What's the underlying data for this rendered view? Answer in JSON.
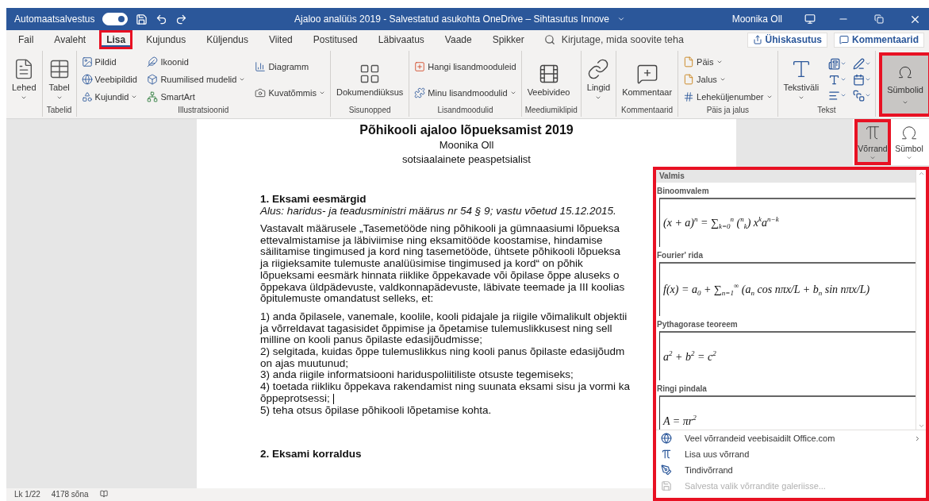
{
  "title_bar": {
    "autosave_label": "Automaatsalvestus",
    "autosave_on": true,
    "title": "Ajaloo analüüs 2019  -  Salvestatud asukohta OneDrive – Sihtasutus Innove",
    "user": "Moonika Oll"
  },
  "tabs": [
    {
      "label": "Fail",
      "selected": false,
      "highlighted": false
    },
    {
      "label": "Avaleht",
      "selected": false,
      "highlighted": false
    },
    {
      "label": "Lisa",
      "selected": true,
      "highlighted": true
    },
    {
      "label": "Kujundus",
      "selected": false,
      "highlighted": false
    },
    {
      "label": "Küljendus",
      "selected": false,
      "highlighted": false
    },
    {
      "label": "Viited",
      "selected": false,
      "highlighted": false
    },
    {
      "label": "Postitused",
      "selected": false,
      "highlighted": false
    },
    {
      "label": "Läbivaatus",
      "selected": false,
      "highlighted": false
    },
    {
      "label": "Vaade",
      "selected": false,
      "highlighted": false
    },
    {
      "label": "Spikker",
      "selected": false,
      "highlighted": false
    }
  ],
  "search": {
    "placeholder": "Kirjutage, mida soovite teha"
  },
  "share_button": "Ühiskasutus",
  "comments_button": "Kommentaarid",
  "ribbon": {
    "groups": [
      {
        "columns": [
          [
            {
              "label": "Lehed",
              "kind": "large",
              "dropdown": true
            }
          ]
        ]
      },
      {
        "label": "Tabelid",
        "columns": [
          [
            {
              "label": "Tabel",
              "kind": "large",
              "dropdown": true
            }
          ]
        ]
      },
      {
        "label": "Illustratsioonid",
        "columns": [
          [
            {
              "label": "Pildid",
              "kind": "small",
              "dropdown": false
            },
            {
              "label": "Veebipildid",
              "kind": "small",
              "dropdown": false
            },
            {
              "label": "Kujundid",
              "kind": "small",
              "dropdown": true
            }
          ],
          [
            {
              "label": "Ikoonid",
              "kind": "small",
              "dropdown": false
            },
            {
              "label": "Ruumilised mudelid",
              "kind": "small",
              "dropdown": true
            },
            {
              "label": "SmartArt",
              "kind": "small",
              "dropdown": false
            }
          ],
          [
            {
              "label": "Diagramm",
              "kind": "small",
              "dropdown": false
            },
            {
              "label": "Kuvatõmmis",
              "kind": "small",
              "dropdown": true
            }
          ]
        ]
      },
      {
        "label": "Sisunopped",
        "columns": [
          [
            {
              "label": "Dokumendiüksus",
              "kind": "large",
              "dropdown": false
            }
          ]
        ]
      },
      {
        "label": "Lisandmoodulid",
        "columns": [
          [
            {
              "label": "Hangi lisandmooduleid",
              "kind": "small",
              "dropdown": false
            },
            {
              "label": "Minu lisandmoodulid",
              "kind": "small",
              "dropdown": true
            }
          ]
        ]
      },
      {
        "label": "Meediumiklipid",
        "columns": [
          [
            {
              "label": "Veebivideo",
              "kind": "large",
              "dropdown": false
            }
          ]
        ]
      },
      {
        "columns": [
          [
            {
              "label": "Lingid",
              "kind": "large",
              "dropdown": true
            }
          ]
        ]
      },
      {
        "label": "Kommentaarid",
        "columns": [
          [
            {
              "label": "Kommentaar",
              "kind": "large",
              "dropdown": false
            }
          ]
        ]
      },
      {
        "label": "Päis ja jalus",
        "columns": [
          [
            {
              "label": "Päis",
              "kind": "small",
              "dropdown": true
            },
            {
              "label": "Jalus",
              "kind": "small",
              "dropdown": true
            },
            {
              "label": "Leheküljenumber",
              "kind": "small",
              "dropdown": true
            }
          ]
        ]
      },
      {
        "label": "Tekst",
        "columns": [
          [
            {
              "label": "Tekstiväli",
              "kind": "large",
              "dropdown": true
            }
          ]
        ]
      }
    ],
    "symbols_button": {
      "label": "Sümbolid",
      "pressed": true,
      "highlighted": true
    }
  },
  "symbols_popup": [
    {
      "label": "Võrrand",
      "pressed": true,
      "highlighted": true
    },
    {
      "label": "Sümbol",
      "pressed": false,
      "highlighted": false
    }
  ],
  "document": {
    "title": "Põhikooli ajaloo lõpueksamist 2019",
    "author": "Moonika Oll",
    "role": "sotsiaalainete peaspetsialist",
    "heading": "1. Eksami eesmärgid",
    "basis": "Alus: haridus- ja teadusministri määrus nr 54 § 9; vastu võetud 15.12.2015.",
    "paragraphs": [
      [
        "Vastavalt määrusele „Tasemetööde ning põhikooli ja gümnaasiumi lõpueksa",
        "ettevalmistamise ja läbiviimise ning eksamitööde koostamise, hindamise",
        "säilitamise tingimused ja kord ning tasemetööde, ühtsete põhikooli lõpueksa",
        "ja riigieksamite tulemuste analüüsimise tingimused ja kord“ on põhik",
        "lõpueksami eesmärk hinnata riiklike õppekavade või õpilase õppe aluseks o",
        "õppekava üldpädevuste, valdkonnapädevuste, läbivate teemade ja III koolias",
        "õpitulemuste omandatust selleks, et:"
      ],
      [
        "1) anda õpilasele, vanemale, koolile, kooli pidajale ja riigile võimalikult objektii",
        "ja võrreldavat tagasisidet õppimise ja õpetamise tulemuslikkusest ning sell",
        "milline on kooli panus õpilaste edasijõudmisse;",
        "2) selgitada, kuidas õppe tulemuslikkus ning kooli panus õpilaste edasijõudm",
        "on ajas muutunud;",
        "3) anda riigile informatsiooni hariduspoliitiliste otsuste tegemiseks;",
        "4) toetada riikliku õppekava rakendamist ning suunata eksami sisu ja vormi ka",
        "õppeprotsessi;",
        "5) teha otsus õpilase põhikooli lõpetamise kohta."
      ]
    ],
    "heading2": "2. Eksami korraldus"
  },
  "equation_gallery": {
    "highlighted": true,
    "section": "Valmis",
    "entries": [
      {
        "title": "Binoomvalem",
        "equation": "(x + a)$^{n}$ = ∑$_{k=0}$$^{n}$ ($^{n}$$_{k}$) x$^{k}$a$^{n−k}$"
      },
      {
        "title": "Fourier' rida",
        "equation": "f(x) = a$_{0}$ + ∑$_{n=1}$$^{∞}$ (a$_{n}$ cos nπx/L + b$_{n}$ sin nπx/L)"
      },
      {
        "title": "Pythagorase teoreem",
        "equation": "a$^{2}$ + b$^{2}$ = c$^{2}$"
      },
      {
        "title": "Ringi pindala",
        "equation": "A = πr$^{2}$"
      }
    ],
    "commands": [
      {
        "label": "Veel võrrandeid veebisaidilt Office.com",
        "submenu": true,
        "disabled": false
      },
      {
        "label": "Lisa uus võrrand",
        "submenu": false,
        "disabled": false
      },
      {
        "label": "Tindivõrrand",
        "submenu": false,
        "disabled": false
      },
      {
        "label": "Salvesta valik võrrandite galeriisse...",
        "submenu": false,
        "disabled": true
      }
    ]
  },
  "status_bar": {
    "page": "Lk 1/22",
    "words": "4178 sõna"
  }
}
